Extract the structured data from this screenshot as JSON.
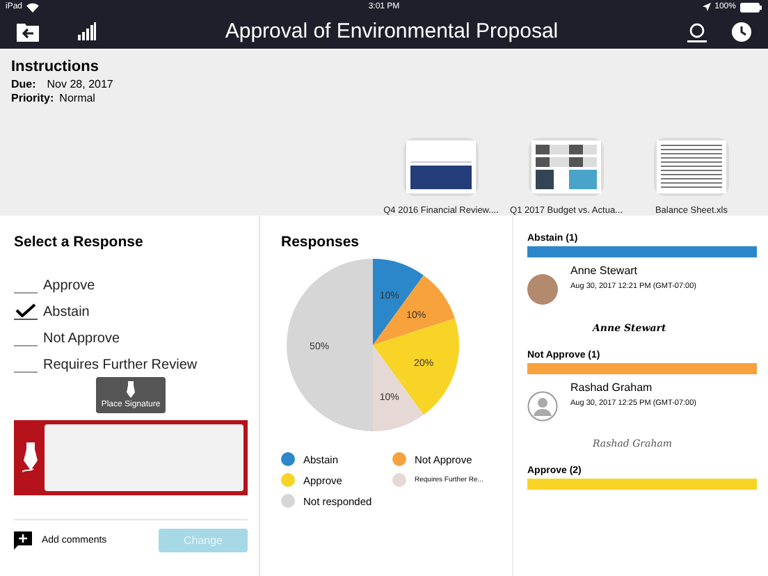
{
  "status_bar": {
    "device": "iPad",
    "time": "3:01 PM",
    "battery": "100%"
  },
  "nav": {
    "title": "Approval of Environmental Proposal"
  },
  "instructions": {
    "heading": "Instructions",
    "due_label": "Due:",
    "due": "Nov 28, 2017",
    "priority_label": "Priority:",
    "priority": "Normal"
  },
  "attachments": [
    {
      "name": "Q4 2016 Financial Review....",
      "kind": "slides"
    },
    {
      "name": "Q1 2017 Budget vs. Actua...",
      "kind": "report"
    },
    {
      "name": "Balance Sheet.xls",
      "kind": "sheet"
    }
  ],
  "response_panel": {
    "heading": "Select a Response",
    "options": [
      {
        "label": "Approve",
        "selected": false
      },
      {
        "label": "Abstain",
        "selected": true
      },
      {
        "label": "Not Approve",
        "selected": false
      },
      {
        "label": "Requires Further Review",
        "selected": false
      }
    ],
    "tooltip": "Place Signature",
    "add_comments": "Add comments",
    "change_button": {
      "label": "Change",
      "disabled": true
    }
  },
  "responses": {
    "heading": "Responses",
    "chart_data": {
      "type": "pie",
      "categories": [
        "Abstain",
        "Not Approve",
        "Approve",
        "Requires Further Re...",
        "Not responded"
      ],
      "values": [
        10,
        10,
        20,
        10,
        50
      ],
      "colors": [
        "#2b87c9",
        "#f7a23c",
        "#f8d426",
        "#e5d8d5",
        "#d6d6d6"
      ],
      "data_labels": true,
      "value_labels": [
        "10%",
        "10%",
        "20%",
        "10%",
        "50%"
      ],
      "legend": "bottom"
    }
  },
  "groups": [
    {
      "title": "Abstain (1)",
      "color": "#2b87c9",
      "entries": [
        {
          "name": "Anne Stewart",
          "date": "Aug 30, 2017 12:21 PM (GMT-07:00)",
          "signature": "Anne Stewart",
          "kind": "photo"
        }
      ]
    },
    {
      "title": "Not Approve (1)",
      "color": "#f7a23c",
      "entries": [
        {
          "name": "Rashad Graham",
          "date": "Aug 30, 2017 12:25 PM (GMT-07:00)",
          "signature": "Rashad Graham",
          "kind": "generic"
        }
      ]
    },
    {
      "title": "Approve (2)",
      "color": "#f8d426"
    }
  ]
}
